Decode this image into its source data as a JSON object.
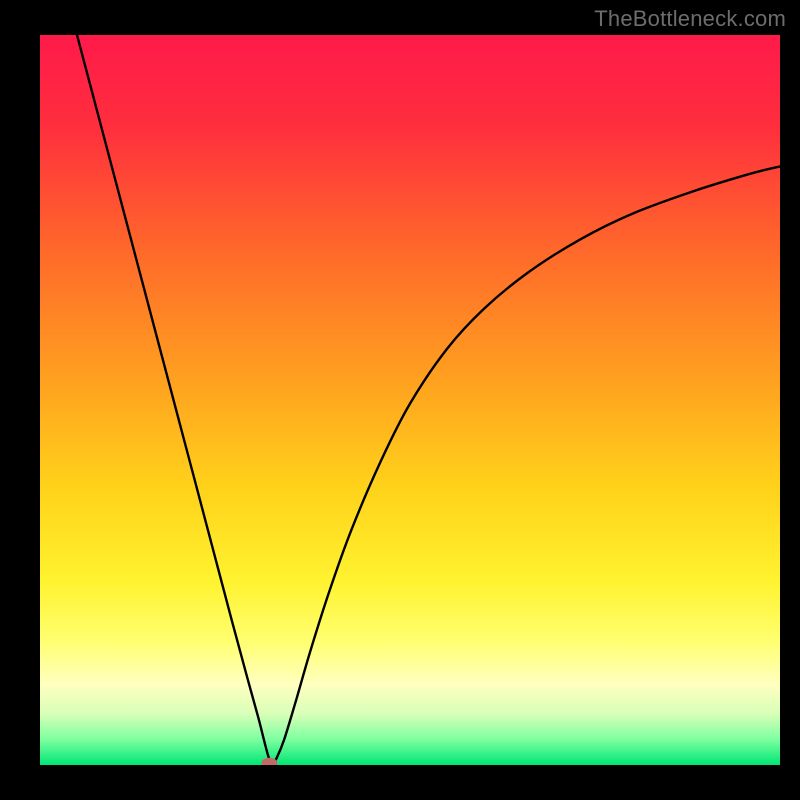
{
  "watermark": "TheBottleneck.com",
  "chart_data": {
    "type": "line",
    "title": "",
    "xlabel": "",
    "ylabel": "",
    "xlim": [
      0,
      100
    ],
    "ylim": [
      0,
      100
    ],
    "background_gradient": {
      "stops": [
        {
          "offset": 0.0,
          "color": "#ff1a4a"
        },
        {
          "offset": 0.12,
          "color": "#ff2d3e"
        },
        {
          "offset": 0.3,
          "color": "#ff6a2a"
        },
        {
          "offset": 0.48,
          "color": "#ffa31f"
        },
        {
          "offset": 0.62,
          "color": "#ffd21a"
        },
        {
          "offset": 0.75,
          "color": "#fff330"
        },
        {
          "offset": 0.83,
          "color": "#ffff70"
        },
        {
          "offset": 0.89,
          "color": "#ffffc0"
        },
        {
          "offset": 0.93,
          "color": "#d8ffb8"
        },
        {
          "offset": 0.965,
          "color": "#7dffa0"
        },
        {
          "offset": 1.0,
          "color": "#00e676"
        }
      ]
    },
    "series": [
      {
        "name": "bottleneck-curve",
        "color": "#000000",
        "x": [
          5.0,
          8.0,
          11.0,
          14.0,
          17.0,
          20.0,
          23.0,
          26.0,
          28.0,
          29.5,
          30.5,
          31.0,
          31.5,
          32.0,
          33.0,
          34.5,
          36.5,
          39.0,
          42.0,
          46.0,
          50.0,
          55.0,
          60.0,
          66.0,
          73.0,
          80.0,
          88.0,
          96.0,
          100.0
        ],
        "y": [
          100.0,
          88.5,
          77.0,
          65.5,
          54.0,
          42.5,
          31.0,
          19.5,
          12.0,
          6.5,
          2.5,
          0.8,
          0.3,
          1.0,
          3.5,
          8.5,
          15.5,
          23.5,
          32.0,
          41.5,
          49.5,
          57.0,
          62.5,
          67.5,
          72.0,
          75.5,
          78.5,
          81.0,
          82.0
        ]
      }
    ],
    "marker": {
      "name": "optimal-point",
      "x": 31.0,
      "y": 0.3,
      "color": "#c26a6a",
      "rx": 8,
      "ry": 5
    }
  }
}
